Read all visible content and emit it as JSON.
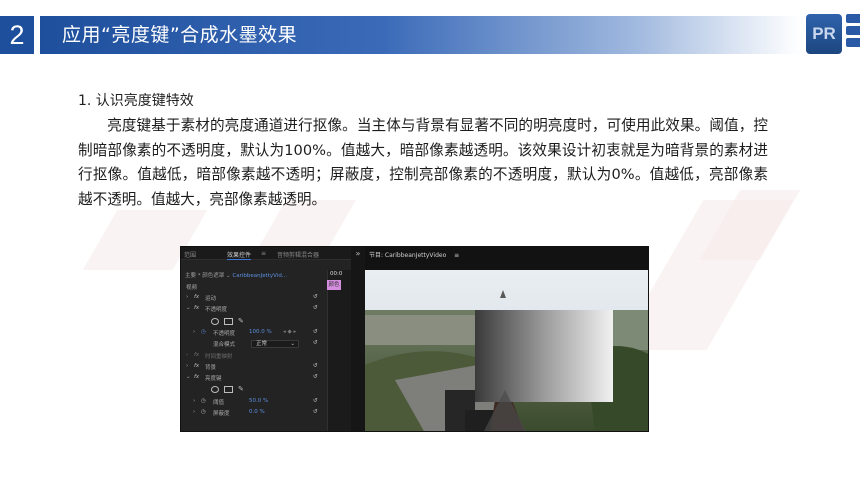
{
  "header": {
    "number": "2",
    "title": "应用“亮度键”合成水墨效果",
    "logo": "PR"
  },
  "section": {
    "heading": "1. 认识亮度键特效",
    "paragraph": "亮度键基于素材的亮度通道进行抠像。当主体与背景有显著不同的明亮度时，可使用此效果。阈值，控制暗部像素的不透明度，默认为100%。值越大，暗部像素越透明。该效果设计初衷就是为暗背景的素材进行抠像。值越低，暗部像素越不透明；屏蔽度，控制亮部像素的不透明度，默认为0%。值越低，亮部像素越不透明。值越大，亮部像素越透明。"
  },
  "screenshot": {
    "tabs": [
      "范围",
      "效果控件",
      "音频剪辑混合器"
    ],
    "tab_menu_icon": "≡",
    "expand_icon": "»",
    "program_title": "节目: CaribbeanJettyVideo",
    "source_line": {
      "prefix": "主要 * 颜色遮罩",
      "clip": "CaribbeanJettyVid..."
    },
    "section_label": "视频",
    "rows": [
      {
        "arrow": "›",
        "fx": "fx",
        "label": "运动"
      },
      {
        "arrow": "⌄",
        "fx": "fx",
        "label": "不透明度"
      },
      {
        "arrow": "›",
        "fx": "",
        "label": "不透明度",
        "value": "100.0 %"
      },
      {
        "arrow": "",
        "fx": "",
        "label": "混合模式",
        "value": "正常"
      },
      {
        "arrow": "›",
        "fx": "fx",
        "label": "时间重映射"
      },
      {
        "arrow": "›",
        "fx": "fx",
        "label": "背景"
      },
      {
        "arrow": "⌄",
        "fx": "fx",
        "label": "亮度键"
      },
      {
        "arrow": "›",
        "fx": "",
        "label": "阈值",
        "value": "50.0 %"
      },
      {
        "arrow": "›",
        "fx": "",
        "label": "屏蔽度",
        "value": "0.0 %"
      }
    ],
    "reset_icon": "↺",
    "timeline_time": "00:0",
    "timeline_clip": "颜色"
  },
  "colors": {
    "header_blue": "#1e4f9c",
    "value_blue": "#5c8fe0",
    "clip_pink": "#d58ee0"
  }
}
